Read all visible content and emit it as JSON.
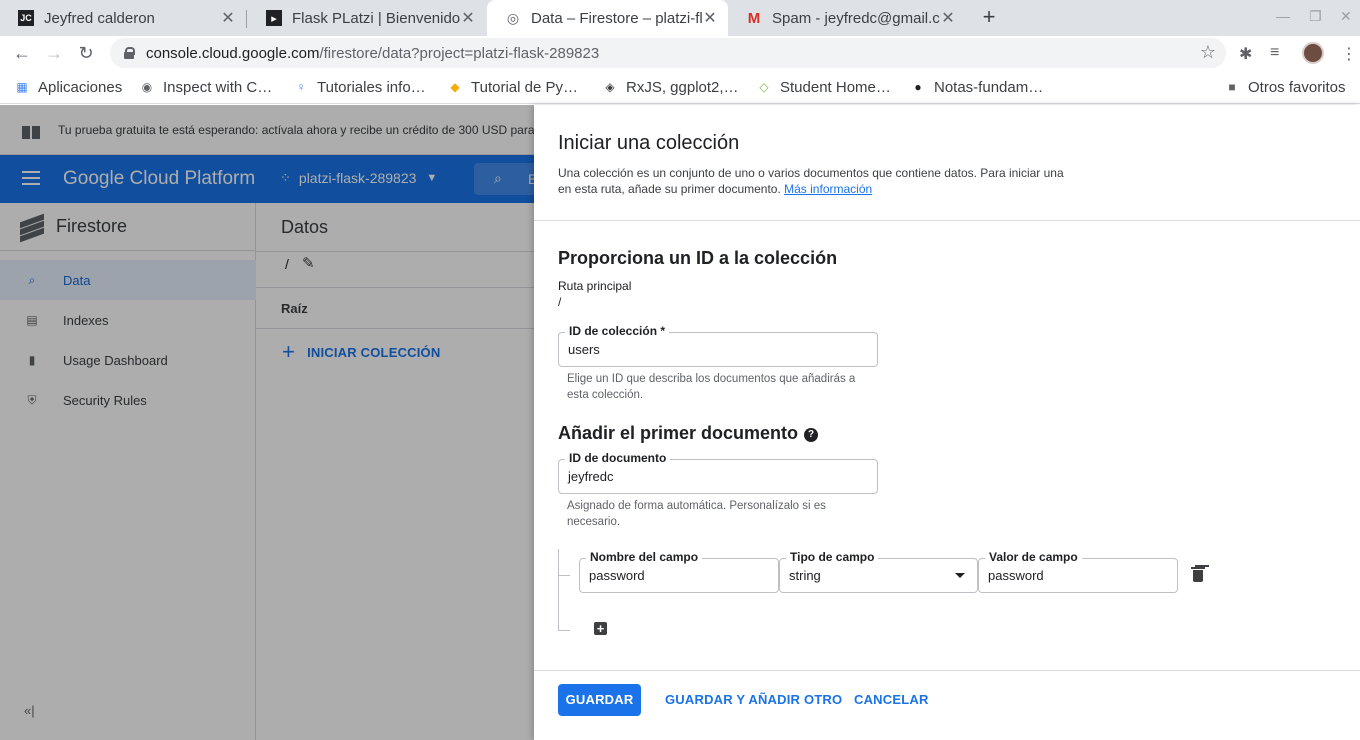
{
  "browser": {
    "tabs": [
      {
        "favicon": "JC",
        "title": "Jeyfred calderon",
        "active": false
      },
      {
        "favicon": "terminal-icon",
        "title": "Flask PLatzi | Bienvenido",
        "active": false
      },
      {
        "favicon": "firestore-icon",
        "title": "Data – Firestore – platzi-fl",
        "active": true
      },
      {
        "favicon": "gmail-icon",
        "title": "Spam - jeyfredc@gmail.co",
        "active": false
      }
    ],
    "url_host": "console.cloud.google.com",
    "url_path": "/firestore/data?project=platzi-flask-289823",
    "bookmarks": [
      {
        "label": "Aplicaciones",
        "icon": "apps-grid-icon"
      },
      {
        "label": "Inspect with C…",
        "icon": "globe-icon"
      },
      {
        "label": "Tutoriales info…",
        "icon": "search-bulb-icon"
      },
      {
        "label": "Tutorial de Py…",
        "icon": "python-icon"
      },
      {
        "label": "RxJS, ggplot2,…",
        "icon": "diamond-icon"
      },
      {
        "label": "Student Home…",
        "icon": "student-icon"
      },
      {
        "label": "Notas-fundam…",
        "icon": "github-icon"
      },
      {
        "label": "Otros favoritos",
        "icon": "folder-icon"
      }
    ]
  },
  "gcp": {
    "trial_banner": "Tu prueba gratuita te está esperando: actívala ahora y recibe un crédito de 300 USD para",
    "brand": "Google Cloud Platform",
    "project": "platzi-flask-289823",
    "search_placeholder": "B",
    "product": "Firestore",
    "nav": [
      {
        "label": "Data",
        "icon": "search-icon",
        "active": true
      },
      {
        "label": "Indexes",
        "icon": "indexes-icon",
        "active": false
      },
      {
        "label": "Usage Dashboard",
        "icon": "bar-chart-icon",
        "active": false
      },
      {
        "label": "Security Rules",
        "icon": "shield-icon",
        "active": false
      }
    ],
    "collapse_icon": "«|",
    "main_title": "Datos",
    "path": "/",
    "root_label": "Raíz",
    "start_collection": "INICIAR COLECCIÓN"
  },
  "dialog": {
    "title": "Iniciar una colección",
    "description": "Una colección es un conjunto de uno o varios documentos que contiene datos. Para iniciar una en esta ruta, añade su primer documento.",
    "more_info": "Más información",
    "id_section_title": "Proporciona un ID a la colección",
    "parent_path_label": "Ruta principal",
    "parent_path_value": "/",
    "collection_id_label": "ID de colección *",
    "collection_id_value": "users",
    "collection_id_hint": "Elige un ID que describa los documentos que añadirás a esta colección.",
    "first_doc_title": "Añadir el primer documento",
    "doc_id_label": "ID de documento",
    "doc_id_value": "jeyfredc",
    "doc_id_hint": "Asignado de forma automática. Personalízalo si es necesario.",
    "field_name_label": "Nombre del campo",
    "field_name_value": "password",
    "field_type_label": "Tipo de campo",
    "field_type_value": "string",
    "field_value_label": "Valor de campo",
    "field_value_value": "password",
    "save": "GUARDAR",
    "save_add": "GUARDAR Y AÑADIR OTRO",
    "cancel": "CANCELAR"
  },
  "colors": {
    "accent": "#1a73e8",
    "header": "#1a73e8",
    "scrim": "rgba(0,0,0,0.32)"
  }
}
